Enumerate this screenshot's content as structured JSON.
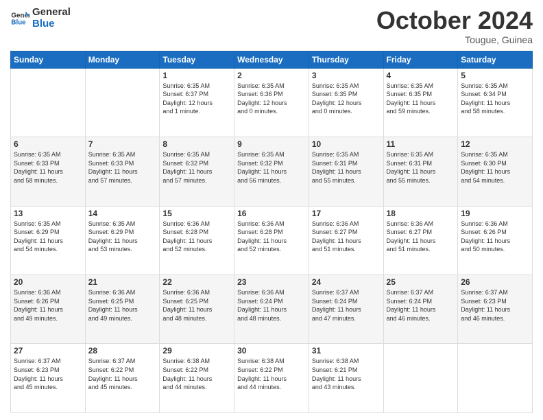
{
  "logo": {
    "line1": "General",
    "line2": "Blue"
  },
  "title": "October 2024",
  "subtitle": "Tougue, Guinea",
  "days_header": [
    "Sunday",
    "Monday",
    "Tuesday",
    "Wednesday",
    "Thursday",
    "Friday",
    "Saturday"
  ],
  "weeks": [
    [
      {
        "day": "",
        "info": ""
      },
      {
        "day": "",
        "info": ""
      },
      {
        "day": "1",
        "info": "Sunrise: 6:35 AM\nSunset: 6:37 PM\nDaylight: 12 hours\nand 1 minute."
      },
      {
        "day": "2",
        "info": "Sunrise: 6:35 AM\nSunset: 6:36 PM\nDaylight: 12 hours\nand 0 minutes."
      },
      {
        "day": "3",
        "info": "Sunrise: 6:35 AM\nSunset: 6:35 PM\nDaylight: 12 hours\nand 0 minutes."
      },
      {
        "day": "4",
        "info": "Sunrise: 6:35 AM\nSunset: 6:35 PM\nDaylight: 11 hours\nand 59 minutes."
      },
      {
        "day": "5",
        "info": "Sunrise: 6:35 AM\nSunset: 6:34 PM\nDaylight: 11 hours\nand 58 minutes."
      }
    ],
    [
      {
        "day": "6",
        "info": "Sunrise: 6:35 AM\nSunset: 6:33 PM\nDaylight: 11 hours\nand 58 minutes."
      },
      {
        "day": "7",
        "info": "Sunrise: 6:35 AM\nSunset: 6:33 PM\nDaylight: 11 hours\nand 57 minutes."
      },
      {
        "day": "8",
        "info": "Sunrise: 6:35 AM\nSunset: 6:32 PM\nDaylight: 11 hours\nand 57 minutes."
      },
      {
        "day": "9",
        "info": "Sunrise: 6:35 AM\nSunset: 6:32 PM\nDaylight: 11 hours\nand 56 minutes."
      },
      {
        "day": "10",
        "info": "Sunrise: 6:35 AM\nSunset: 6:31 PM\nDaylight: 11 hours\nand 55 minutes."
      },
      {
        "day": "11",
        "info": "Sunrise: 6:35 AM\nSunset: 6:31 PM\nDaylight: 11 hours\nand 55 minutes."
      },
      {
        "day": "12",
        "info": "Sunrise: 6:35 AM\nSunset: 6:30 PM\nDaylight: 11 hours\nand 54 minutes."
      }
    ],
    [
      {
        "day": "13",
        "info": "Sunrise: 6:35 AM\nSunset: 6:29 PM\nDaylight: 11 hours\nand 54 minutes."
      },
      {
        "day": "14",
        "info": "Sunrise: 6:35 AM\nSunset: 6:29 PM\nDaylight: 11 hours\nand 53 minutes."
      },
      {
        "day": "15",
        "info": "Sunrise: 6:36 AM\nSunset: 6:28 PM\nDaylight: 11 hours\nand 52 minutes."
      },
      {
        "day": "16",
        "info": "Sunrise: 6:36 AM\nSunset: 6:28 PM\nDaylight: 11 hours\nand 52 minutes."
      },
      {
        "day": "17",
        "info": "Sunrise: 6:36 AM\nSunset: 6:27 PM\nDaylight: 11 hours\nand 51 minutes."
      },
      {
        "day": "18",
        "info": "Sunrise: 6:36 AM\nSunset: 6:27 PM\nDaylight: 11 hours\nand 51 minutes."
      },
      {
        "day": "19",
        "info": "Sunrise: 6:36 AM\nSunset: 6:26 PM\nDaylight: 11 hours\nand 50 minutes."
      }
    ],
    [
      {
        "day": "20",
        "info": "Sunrise: 6:36 AM\nSunset: 6:26 PM\nDaylight: 11 hours\nand 49 minutes."
      },
      {
        "day": "21",
        "info": "Sunrise: 6:36 AM\nSunset: 6:25 PM\nDaylight: 11 hours\nand 49 minutes."
      },
      {
        "day": "22",
        "info": "Sunrise: 6:36 AM\nSunset: 6:25 PM\nDaylight: 11 hours\nand 48 minutes."
      },
      {
        "day": "23",
        "info": "Sunrise: 6:36 AM\nSunset: 6:24 PM\nDaylight: 11 hours\nand 48 minutes."
      },
      {
        "day": "24",
        "info": "Sunrise: 6:37 AM\nSunset: 6:24 PM\nDaylight: 11 hours\nand 47 minutes."
      },
      {
        "day": "25",
        "info": "Sunrise: 6:37 AM\nSunset: 6:24 PM\nDaylight: 11 hours\nand 46 minutes."
      },
      {
        "day": "26",
        "info": "Sunrise: 6:37 AM\nSunset: 6:23 PM\nDaylight: 11 hours\nand 46 minutes."
      }
    ],
    [
      {
        "day": "27",
        "info": "Sunrise: 6:37 AM\nSunset: 6:23 PM\nDaylight: 11 hours\nand 45 minutes."
      },
      {
        "day": "28",
        "info": "Sunrise: 6:37 AM\nSunset: 6:22 PM\nDaylight: 11 hours\nand 45 minutes."
      },
      {
        "day": "29",
        "info": "Sunrise: 6:38 AM\nSunset: 6:22 PM\nDaylight: 11 hours\nand 44 minutes."
      },
      {
        "day": "30",
        "info": "Sunrise: 6:38 AM\nSunset: 6:22 PM\nDaylight: 11 hours\nand 44 minutes."
      },
      {
        "day": "31",
        "info": "Sunrise: 6:38 AM\nSunset: 6:21 PM\nDaylight: 11 hours\nand 43 minutes."
      },
      {
        "day": "",
        "info": ""
      },
      {
        "day": "",
        "info": ""
      }
    ]
  ]
}
